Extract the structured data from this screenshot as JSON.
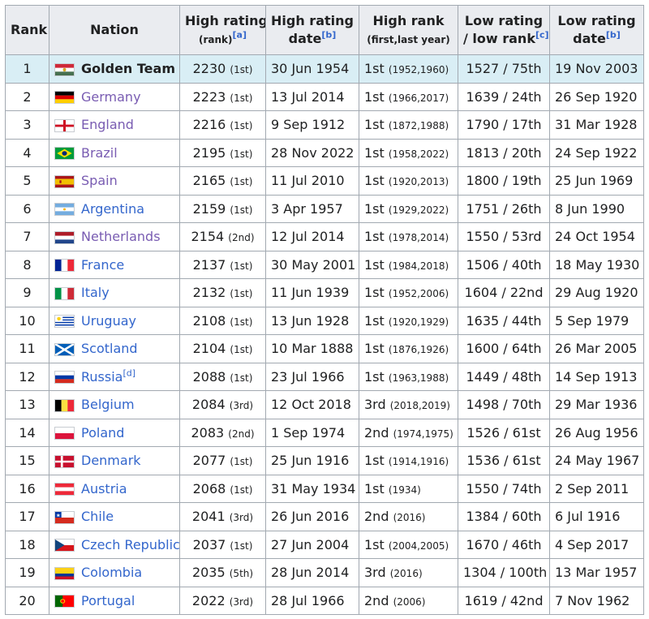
{
  "headers": {
    "rank": "Rank",
    "nation": "Nation",
    "high_rating_main": "High rating",
    "high_rating_sub": "(rank)",
    "high_rating_note": "[a]",
    "high_rating_date_main": "High rating",
    "high_rating_date_sub": "date",
    "high_rating_date_note": "[b]",
    "high_rank_main": "High rank",
    "high_rank_sub": "(first,last year)",
    "low_main": "Low rating",
    "low_sub": "/ low rank",
    "low_note": "[c]",
    "low_date_main": "Low rating",
    "low_date_sub": "date",
    "low_date_note": "[b]"
  },
  "rows": [
    {
      "rank": "1",
      "nation": "Golden Team",
      "note": "",
      "flag": "hungary",
      "style": "bold",
      "high_rating": "2230",
      "high_rank": "(1st)",
      "high_date": "30 Jun 1954",
      "best_rank": "1st",
      "best_years": "(1952,1960)",
      "low": "1527 / 75th",
      "low_date": "19 Nov 2003"
    },
    {
      "rank": "2",
      "nation": "Germany",
      "note": "",
      "flag": "germany",
      "style": "visited",
      "high_rating": "2223",
      "high_rank": "(1st)",
      "high_date": "13 Jul 2014",
      "best_rank": "1st",
      "best_years": "(1966,2017)",
      "low": "1639 / 24th",
      "low_date": "26 Sep 1920"
    },
    {
      "rank": "3",
      "nation": "England",
      "note": "",
      "flag": "england",
      "style": "visited",
      "high_rating": "2216",
      "high_rank": "(1st)",
      "high_date": "9 Sep 1912",
      "best_rank": "1st",
      "best_years": "(1872,1988)",
      "low": "1790 / 17th",
      "low_date": "31 Mar 1928"
    },
    {
      "rank": "4",
      "nation": "Brazil",
      "note": "",
      "flag": "brazil",
      "style": "visited",
      "high_rating": "2195",
      "high_rank": "(1st)",
      "high_date": "28 Nov 2022",
      "best_rank": "1st",
      "best_years": "(1958,2022)",
      "low": "1813 / 20th",
      "low_date": "24 Sep 1922"
    },
    {
      "rank": "5",
      "nation": "Spain",
      "note": "",
      "flag": "spain",
      "style": "visited",
      "high_rating": "2165",
      "high_rank": "(1st)",
      "high_date": "11 Jul 2010",
      "best_rank": "1st",
      "best_years": "(1920,2013)",
      "low": "1800 / 19th",
      "low_date": "25 Jun 1969"
    },
    {
      "rank": "6",
      "nation": "Argentina",
      "note": "",
      "flag": "argentina",
      "style": "link",
      "high_rating": "2159",
      "high_rank": "(1st)",
      "high_date": "3 Apr 1957",
      "best_rank": "1st",
      "best_years": "(1929,2022)",
      "low": "1751 / 26th",
      "low_date": "8 Jun 1990"
    },
    {
      "rank": "7",
      "nation": "Netherlands",
      "note": "",
      "flag": "netherlands",
      "style": "visited",
      "high_rating": "2154",
      "high_rank": "(2nd)",
      "high_date": "12 Jul 2014",
      "best_rank": "1st",
      "best_years": "(1978,2014)",
      "low": "1550 / 53rd",
      "low_date": "24 Oct 1954"
    },
    {
      "rank": "8",
      "nation": "France",
      "note": "",
      "flag": "france",
      "style": "link",
      "high_rating": "2137",
      "high_rank": "(1st)",
      "high_date": "30 May 2001",
      "best_rank": "1st",
      "best_years": "(1984,2018)",
      "low": "1506 / 40th",
      "low_date": "18 May 1930"
    },
    {
      "rank": "9",
      "nation": "Italy",
      "note": "",
      "flag": "italy",
      "style": "link",
      "high_rating": "2132",
      "high_rank": "(1st)",
      "high_date": "11 Jun 1939",
      "best_rank": "1st",
      "best_years": "(1952,2006)",
      "low": "1604 / 22nd",
      "low_date": "29 Aug 1920"
    },
    {
      "rank": "10",
      "nation": "Uruguay",
      "note": "",
      "flag": "uruguay",
      "style": "link",
      "high_rating": "2108",
      "high_rank": "(1st)",
      "high_date": "13 Jun 1928",
      "best_rank": "1st",
      "best_years": "(1920,1929)",
      "low": "1635 / 44th",
      "low_date": "5 Sep 1979"
    },
    {
      "rank": "11",
      "nation": "Scotland",
      "note": "",
      "flag": "scotland",
      "style": "link",
      "high_rating": "2104",
      "high_rank": "(1st)",
      "high_date": "10 Mar 1888",
      "best_rank": "1st",
      "best_years": "(1876,1926)",
      "low": "1600 / 64th",
      "low_date": "26 Mar 2005"
    },
    {
      "rank": "12",
      "nation": "Russia",
      "note": "[d]",
      "flag": "russia",
      "style": "link",
      "high_rating": "2088",
      "high_rank": "(1st)",
      "high_date": "23 Jul 1966",
      "best_rank": "1st",
      "best_years": "(1963,1988)",
      "low": "1449 / 48th",
      "low_date": "14 Sep 1913"
    },
    {
      "rank": "13",
      "nation": "Belgium",
      "note": "",
      "flag": "belgium",
      "style": "link",
      "high_rating": "2084",
      "high_rank": "(3rd)",
      "high_date": "12 Oct 2018",
      "best_rank": "3rd",
      "best_years": "(2018,2019)",
      "low": "1498 / 70th",
      "low_date": "29 Mar 1936"
    },
    {
      "rank": "14",
      "nation": "Poland",
      "note": "",
      "flag": "poland",
      "style": "link",
      "high_rating": "2083",
      "high_rank": "(2nd)",
      "high_date": "1 Sep 1974",
      "best_rank": "2nd",
      "best_years": "(1974,1975)",
      "low": "1526 / 61st",
      "low_date": "26 Aug 1956"
    },
    {
      "rank": "15",
      "nation": "Denmark",
      "note": "",
      "flag": "denmark",
      "style": "link",
      "high_rating": "2077",
      "high_rank": "(1st)",
      "high_date": "25 Jun 1916",
      "best_rank": "1st",
      "best_years": "(1914,1916)",
      "low": "1536 / 61st",
      "low_date": "24 May 1967"
    },
    {
      "rank": "16",
      "nation": "Austria",
      "note": "",
      "flag": "austria",
      "style": "link",
      "high_rating": "2068",
      "high_rank": "(1st)",
      "high_date": "31 May 1934",
      "best_rank": "1st",
      "best_years": "(1934)",
      "low": "1550 / 74th",
      "low_date": "2 Sep 2011"
    },
    {
      "rank": "17",
      "nation": "Chile",
      "note": "",
      "flag": "chile",
      "style": "link",
      "high_rating": "2041",
      "high_rank": "(3rd)",
      "high_date": "26 Jun 2016",
      "best_rank": "2nd",
      "best_years": "(2016)",
      "low": "1384 / 60th",
      "low_date": "6 Jul 1916"
    },
    {
      "rank": "18",
      "nation": "Czech Republic",
      "note": "",
      "flag": "czech",
      "style": "link",
      "high_rating": "2037",
      "high_rank": "(1st)",
      "high_date": "27 Jun 2004",
      "best_rank": "1st",
      "best_years": "(2004,2005)",
      "low": "1670 / 46th",
      "low_date": "4 Sep 2017"
    },
    {
      "rank": "19",
      "nation": "Colombia",
      "note": "",
      "flag": "colombia",
      "style": "link",
      "high_rating": "2035",
      "high_rank": "(5th)",
      "high_date": "28 Jun 2014",
      "best_rank": "3rd",
      "best_years": "(2016)",
      "low": "1304 / 100th",
      "low_date": "13 Mar 1957"
    },
    {
      "rank": "20",
      "nation": "Portugal",
      "note": "",
      "flag": "portugal",
      "style": "link",
      "high_rating": "2022",
      "high_rank": "(3rd)",
      "high_date": "28 Jul 1966",
      "best_rank": "2nd",
      "best_years": "(2006)",
      "low": "1619 / 42nd",
      "low_date": "7 Nov 1962"
    }
  ]
}
